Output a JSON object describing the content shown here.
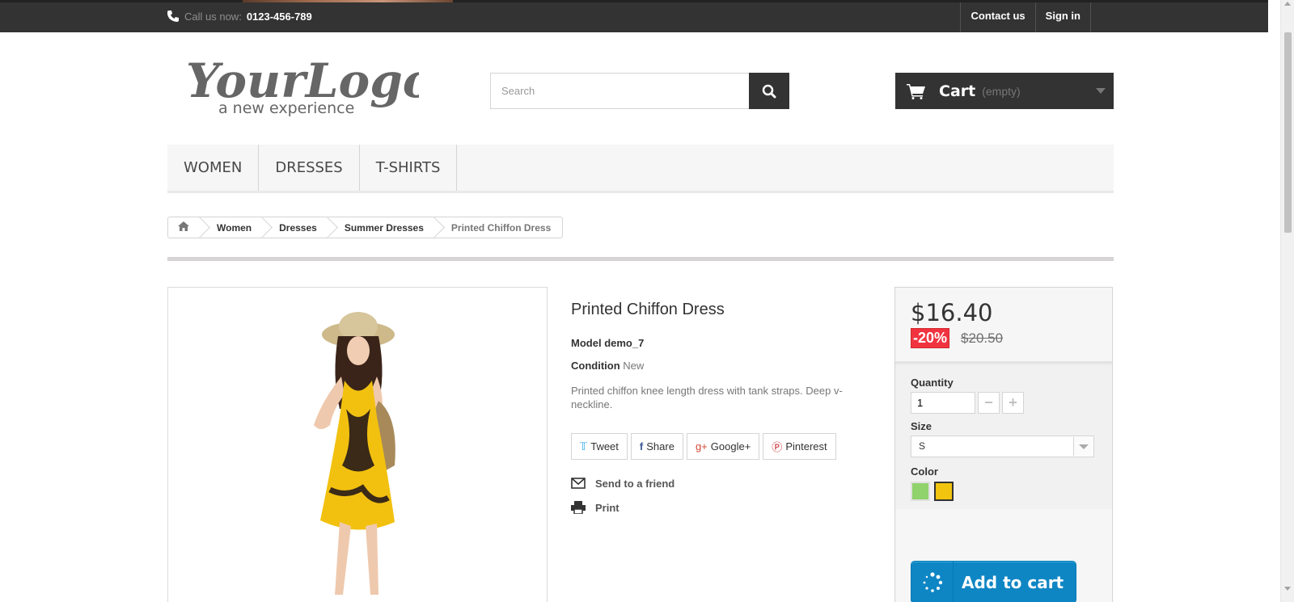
{
  "topbar": {
    "call_label": "Call us now:",
    "phone": "0123-456-789",
    "nav": [
      "Contact us",
      "Sign in"
    ]
  },
  "header": {
    "logo_title": "YourLogo",
    "logo_tagline": "a new experience",
    "search_placeholder": "Search",
    "cart_label": "Cart",
    "cart_status": "(empty)"
  },
  "menu": [
    "WOMEN",
    "DRESSES",
    "T-SHIRTS"
  ],
  "breadcrumb": [
    "Women",
    "Dresses",
    "Summer Dresses",
    "Printed Chiffon Dress"
  ],
  "product": {
    "name": "Printed Chiffon Dress",
    "model_label": "Model",
    "model": "demo_7",
    "condition_label": "Condition",
    "condition": "New",
    "description": "Printed chiffon knee length dress with tank straps. Deep v-neckline.",
    "social": [
      "Tweet",
      "Share",
      "Google+",
      "Pinterest"
    ],
    "send_to_friend": "Send to a friend",
    "print": "Print"
  },
  "buybox": {
    "price": "$16.40",
    "discount": "-20%",
    "old_price": "$20.50",
    "quantity_label": "Quantity",
    "quantity": "1",
    "size_label": "Size",
    "size": "S",
    "color_label": "Color",
    "colors": [
      "#90d26c",
      "#f1c40f"
    ],
    "add_to_cart": "Add to cart"
  }
}
